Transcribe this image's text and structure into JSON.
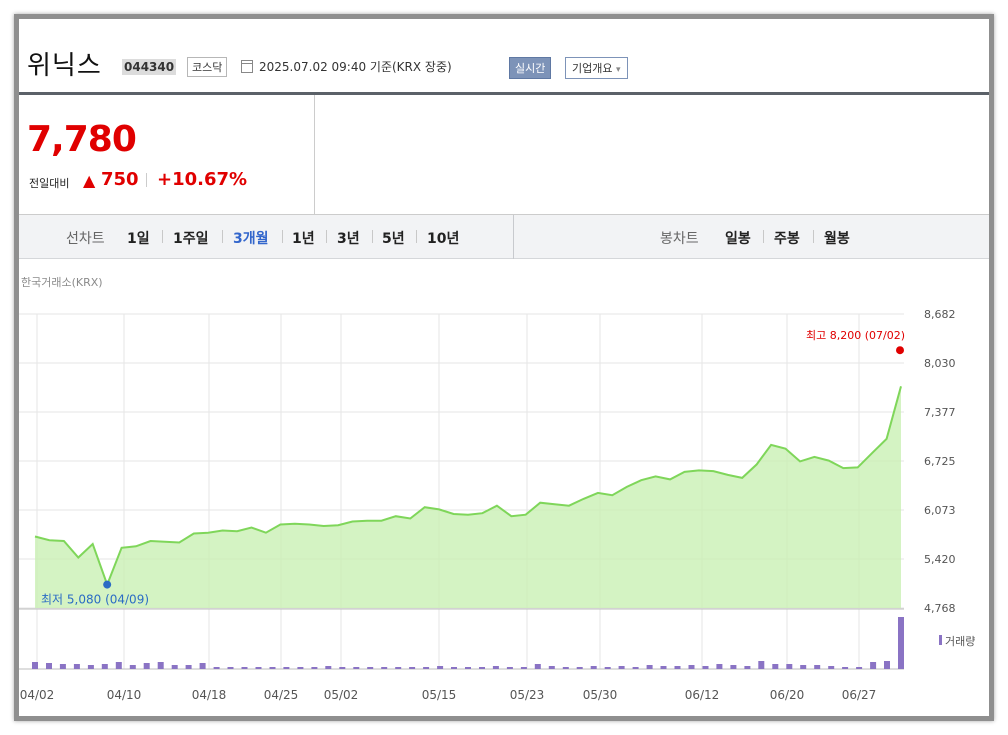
{
  "header": {
    "name": "위닉스",
    "code": "044340",
    "market": "코스닥",
    "basis": "2025.07.02 09:40  기준(KRX 장중)",
    "realtime_label": "실시간",
    "company_label": "기업개요",
    "company_caret": "▾"
  },
  "quote": {
    "price": "7,780",
    "change_label": "전일대비",
    "change_arrow": "▲",
    "change_value": "750",
    "change_pct": "+10.67%",
    "up_color": "#e00000"
  },
  "tabs": {
    "period_category": "선차트",
    "periods": [
      "1일",
      "1주일",
      "3개월",
      "1년",
      "3년",
      "5년",
      "10년"
    ],
    "active_period": "3개월",
    "candle_category": "봉차트",
    "candles": [
      "일봉",
      "주봉",
      "월봉"
    ]
  },
  "chart_data": {
    "type": "area",
    "source": "한국거래소(KRX)",
    "y_ticks": [
      "8,682",
      "8,030",
      "7,377",
      "6,725",
      "6,073",
      "5,420",
      "4,768"
    ],
    "ylim": [
      4768,
      8682
    ],
    "x_ticks": [
      "04/02",
      "04/10",
      "04/18",
      "04/25",
      "05/02",
      "05/15",
      "05/23",
      "05/30",
      "06/12",
      "06/20",
      "06/27"
    ],
    "price_series": [
      5720,
      5670,
      5660,
      5440,
      5620,
      5080,
      5570,
      5590,
      5660,
      5650,
      5640,
      5760,
      5770,
      5800,
      5790,
      5840,
      5770,
      5880,
      5890,
      5880,
      5860,
      5870,
      5920,
      5930,
      5930,
      5990,
      5960,
      6110,
      6080,
      6020,
      6010,
      6030,
      6130,
      5990,
      6010,
      6170,
      6150,
      6130,
      6220,
      6300,
      6270,
      6380,
      6470,
      6520,
      6480,
      6580,
      6600,
      6590,
      6540,
      6500,
      6680,
      6940,
      6890,
      6720,
      6780,
      6730,
      6630,
      6640,
      6830,
      7020,
      7720
    ],
    "high": {
      "label": "최고 8,200 (07/02)",
      "value": 8200
    },
    "low": {
      "label": "최저 5,080 (04/09)",
      "value": 5080
    },
    "volume_label": "거래량",
    "volume_series": [
      7,
      6,
      5,
      5,
      4,
      5,
      7,
      4,
      6,
      7,
      4,
      4,
      6,
      2,
      2,
      2,
      2,
      2,
      2,
      2,
      2,
      3,
      2,
      2,
      2,
      2,
      2,
      2,
      2,
      3,
      2,
      2,
      2,
      3,
      2,
      2,
      5,
      3,
      2,
      2,
      3,
      2,
      3,
      2,
      4,
      3,
      3,
      4,
      3,
      5,
      4,
      3,
      8,
      5,
      5,
      4,
      4,
      3,
      2,
      2,
      7,
      8,
      52
    ],
    "line_color": "#7fd65a",
    "fill_color": "#c9f0b4",
    "volume_color": "#8a73c4",
    "high_color": "#e00000",
    "low_color": "#2b6cc4",
    "grid": true
  }
}
